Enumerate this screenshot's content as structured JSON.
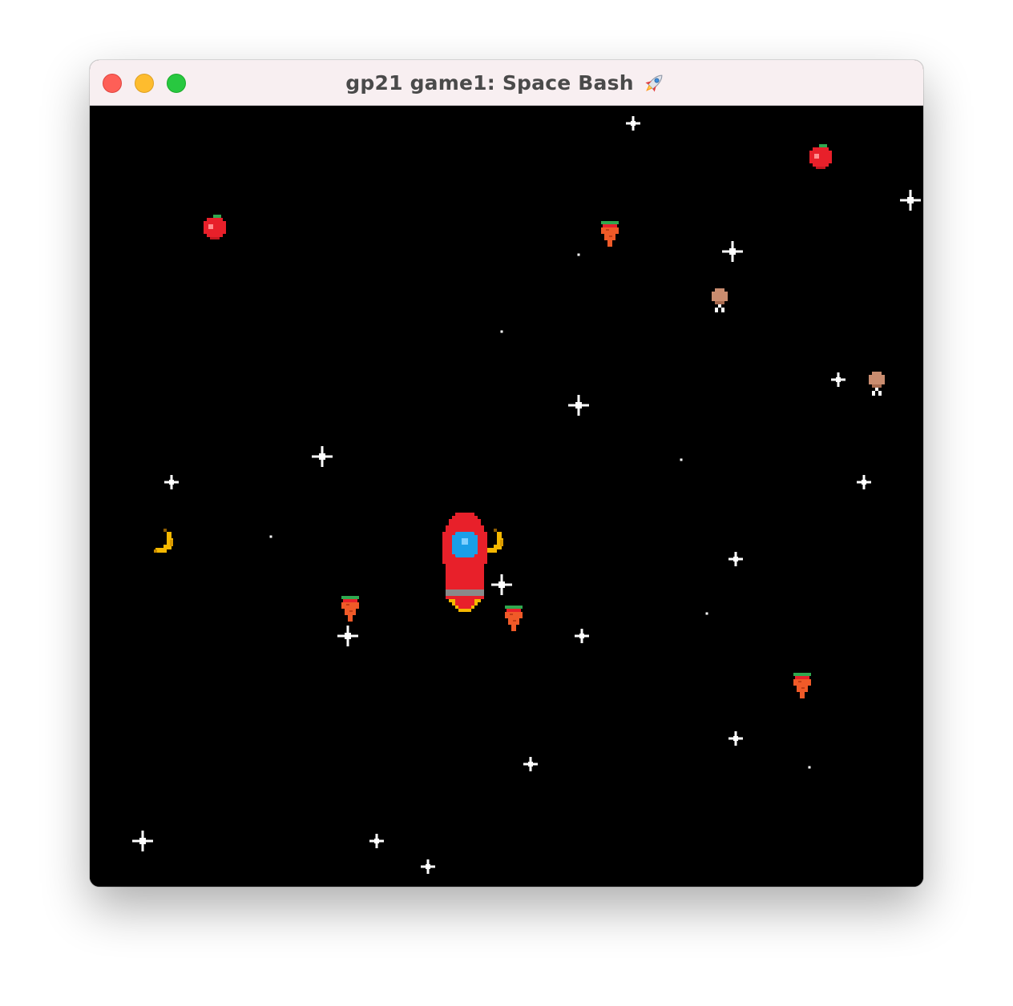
{
  "window": {
    "title": "gp21 game1: Space Bash",
    "title_icon": "rocket-icon"
  },
  "colors": {
    "titlebar_bg": "#f8eff1",
    "space_bg": "#000000",
    "rocket_body": "#e8202a",
    "rocket_window": "#1a9fe8",
    "flame": "#f5b800",
    "star": "#ffffff"
  },
  "scene": {
    "player": "rocket-ship",
    "items": [
      "apple",
      "apple",
      "carrot",
      "carrot",
      "carrot",
      "carrot",
      "drumstick",
      "drumstick",
      "banana",
      "banana"
    ]
  }
}
